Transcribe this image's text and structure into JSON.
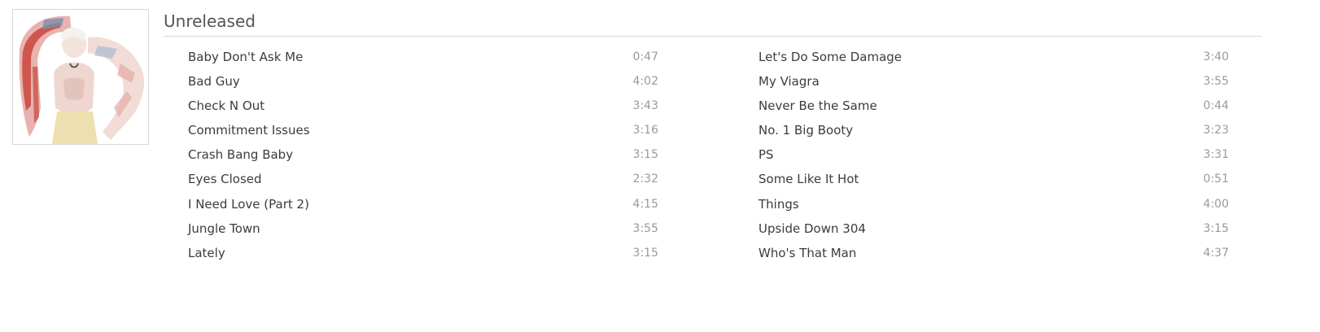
{
  "album": {
    "title": "Unreleased",
    "artwork": "album-cover-image"
  },
  "tracks_left": [
    {
      "name": "Baby Don't Ask Me",
      "duration": "0:47"
    },
    {
      "name": "Bad Guy",
      "duration": "4:02"
    },
    {
      "name": "Check N Out",
      "duration": "3:43"
    },
    {
      "name": "Commitment Issues",
      "duration": "3:16"
    },
    {
      "name": "Crash Bang Baby",
      "duration": "3:15"
    },
    {
      "name": "Eyes Closed",
      "duration": "2:32"
    },
    {
      "name": "I Need Love (Part 2)",
      "duration": "4:15"
    },
    {
      "name": "Jungle Town",
      "duration": "3:55"
    },
    {
      "name": "Lately",
      "duration": "3:15"
    }
  ],
  "tracks_right": [
    {
      "name": "Let's Do Some Damage",
      "duration": "3:40"
    },
    {
      "name": "My Viagra",
      "duration": "3:55"
    },
    {
      "name": "Never Be the Same",
      "duration": "0:44"
    },
    {
      "name": "No. 1 Big Booty",
      "duration": "3:23"
    },
    {
      "name": "PS",
      "duration": "3:31"
    },
    {
      "name": "Some Like It Hot",
      "duration": "0:51"
    },
    {
      "name": "Things",
      "duration": "4:00"
    },
    {
      "name": "Upside Down 304",
      "duration": "3:15"
    },
    {
      "name": "Who's That Man",
      "duration": "4:37"
    }
  ],
  "colors": {
    "title": "#545454",
    "track_name": "#3c3c3c",
    "duration": "#9a9a9a",
    "divider": "#d8d8d8"
  }
}
